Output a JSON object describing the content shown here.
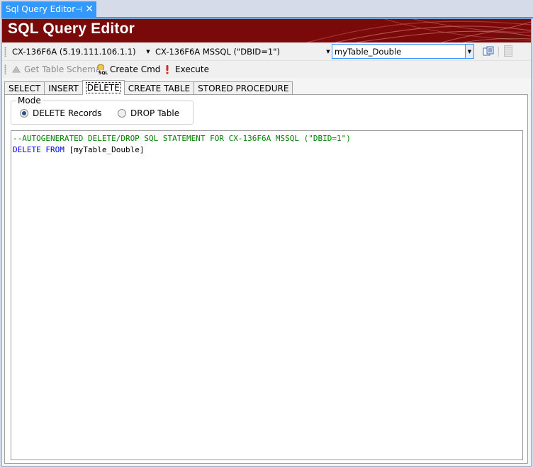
{
  "document_tab": {
    "title": "Sql Query Editor",
    "pin_glyph": "⊣",
    "close_glyph": "✕"
  },
  "banner": {
    "title": "SQL Query Editor",
    "colors": {
      "background": "#7a0a0a",
      "accent": "#a01a1a"
    }
  },
  "combos": {
    "server": {
      "value": "CX-136F6A (5.19.111.106.1.1)"
    },
    "database": {
      "value": "CX-136F6A MSSQL (\"DBID=1\")"
    },
    "table": {
      "value": "myTable_Double"
    }
  },
  "toolbar": {
    "get_schema_label": "Get Table Schema",
    "create_cmd_label": "Create Cmd",
    "execute_label": "Execute"
  },
  "tabs": [
    {
      "label": "SELECT",
      "active": false
    },
    {
      "label": "INSERT",
      "active": false
    },
    {
      "label": "DELETE",
      "active": true
    },
    {
      "label": "CREATE TABLE",
      "active": false
    },
    {
      "label": "STORED PROCEDURE",
      "active": false
    }
  ],
  "mode": {
    "legend": "Mode",
    "options": [
      {
        "label": "DELETE Records",
        "selected": true
      },
      {
        "label": "DROP Table",
        "selected": false
      }
    ]
  },
  "editor": {
    "comment_line": "--AUTOGENERATED DELETE/DROP SQL STATEMENT FOR CX-136F6A MSSQL (\"DBID=1\")",
    "keyword": "DELETE FROM",
    "target": " [myTable_Double]",
    "colors": {
      "comment": "#008000",
      "keyword": "#0000ff"
    }
  }
}
